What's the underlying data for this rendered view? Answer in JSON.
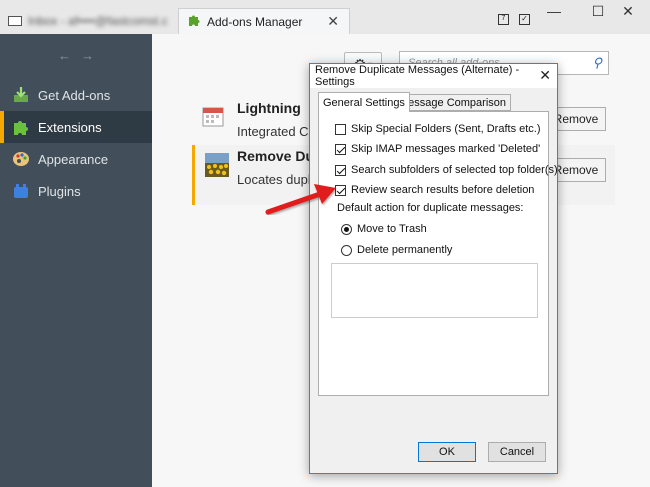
{
  "tabs": [
    {
      "label": "Inbox - af••••@fastcomst.co•••",
      "active": false
    },
    {
      "label": "Add-ons Manager",
      "active": true
    }
  ],
  "sidebar": {
    "items": [
      {
        "label": "Get Add-ons",
        "icon": "get-addons-icon",
        "selected": false
      },
      {
        "label": "Extensions",
        "icon": "puzzle-icon",
        "selected": true
      },
      {
        "label": "Appearance",
        "icon": "palette-icon",
        "selected": false
      },
      {
        "label": "Plugins",
        "icon": "plugin-block-icon",
        "selected": false
      }
    ]
  },
  "toolbar": {
    "search_placeholder": "Search all add-ons"
  },
  "addons": [
    {
      "name": "Lightning",
      "desc": "Integrated Cal",
      "remove_label": "Remove"
    },
    {
      "name": "Remove Dup",
      "desc": "Locates duplic",
      "remove_label": "Remove"
    }
  ],
  "dialog": {
    "title": "Remove Duplicate Messages (Alternate) - Settings",
    "tabs": [
      {
        "label": "General Settings",
        "active": true
      },
      {
        "label": "Message Comparison",
        "active": false
      }
    ],
    "options": [
      {
        "label": "Skip Special Folders (Sent, Drafts etc.)",
        "checked": false
      },
      {
        "label": "Skip IMAP messages marked 'Deleted'",
        "checked": true
      },
      {
        "label": "Search subfolders of selected top folder(s)",
        "checked": true
      },
      {
        "label": "Review search results before deletion",
        "checked": true
      }
    ],
    "group_label": "Default action for duplicate messages:",
    "radios": [
      {
        "label": "Move to Trash",
        "selected": true
      },
      {
        "label": "Delete permanently",
        "selected": false
      }
    ],
    "ok_label": "OK",
    "cancel_label": "Cancel"
  },
  "colors": {
    "sidebar_bg": "#424f5a",
    "accent": "#f7a800",
    "arrow": "#e01f1f",
    "dialog_border": "#3c83c4"
  }
}
